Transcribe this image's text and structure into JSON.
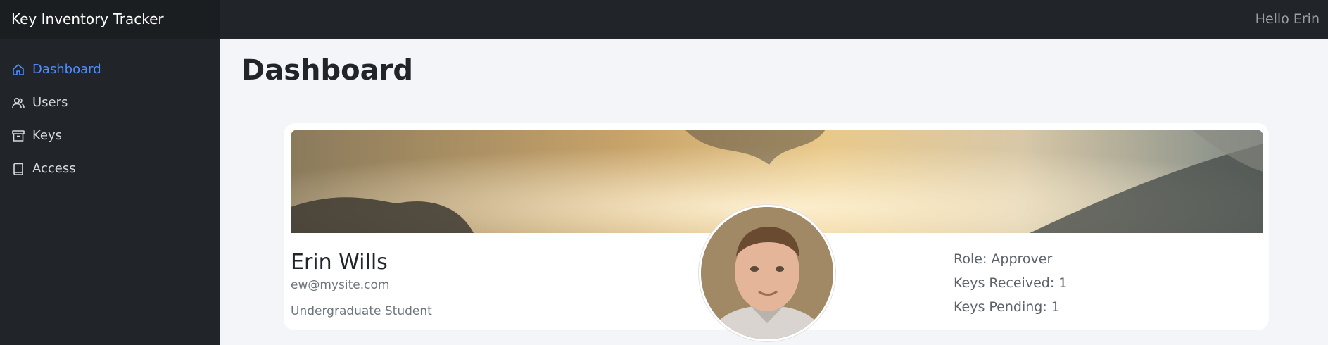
{
  "app": {
    "brand": "Key Inventory Tracker",
    "greeting": "Hello Erin"
  },
  "sidebar": {
    "items": [
      {
        "label": "Dashboard",
        "icon": "home-icon",
        "active": true
      },
      {
        "label": "Users",
        "icon": "users-icon",
        "active": false
      },
      {
        "label": "Keys",
        "icon": "archive-icon",
        "active": false
      },
      {
        "label": "Access",
        "icon": "book-icon",
        "active": false
      }
    ]
  },
  "page": {
    "title": "Dashboard"
  },
  "profile": {
    "name": "Erin Wills",
    "email": "ew@mysite.com",
    "bio": "Undergraduate Student",
    "stats": [
      {
        "text": "Role: Approver"
      },
      {
        "text": "Keys Received: 1"
      },
      {
        "text": "Keys Pending: 1"
      }
    ]
  },
  "colors": {
    "accent": "#4d8dff",
    "sidebar": "#212529",
    "background": "#f4f5f9"
  }
}
